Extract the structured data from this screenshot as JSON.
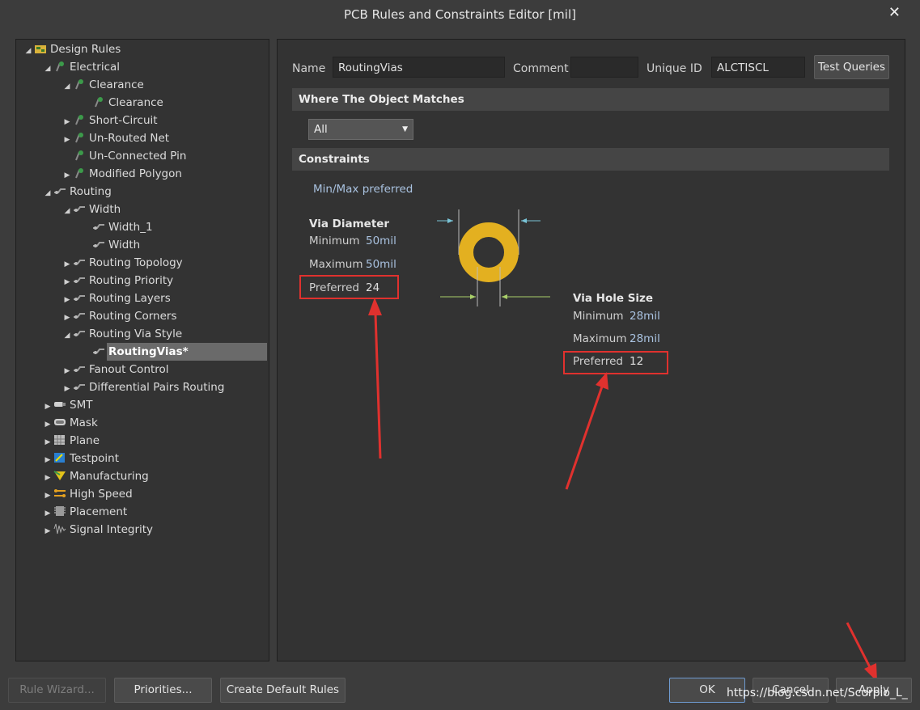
{
  "window": {
    "title": "PCB Rules and Constraints Editor [mil]"
  },
  "tree": [
    {
      "label": "Design Rules",
      "arrow": "◢",
      "icon": "rules-icon"
    },
    {
      "label": "Electrical",
      "arrow": "◢",
      "icon": "electrical-icon"
    },
    {
      "label": "Clearance",
      "arrow": "◢",
      "icon": "electrical-icon"
    },
    {
      "label": "Clearance",
      "arrow": "",
      "icon": "electrical-icon"
    },
    {
      "label": "Short-Circuit",
      "arrow": "▶",
      "icon": "electrical-icon"
    },
    {
      "label": "Un-Routed Net",
      "arrow": "▶",
      "icon": "electrical-icon"
    },
    {
      "label": "Un-Connected Pin",
      "arrow": "",
      "icon": "electrical-icon"
    },
    {
      "label": "Modified Polygon",
      "arrow": "▶",
      "icon": "electrical-icon"
    },
    {
      "label": "Routing",
      "arrow": "◢",
      "icon": "routing-icon"
    },
    {
      "label": "Width",
      "arrow": "◢",
      "icon": "routing-icon"
    },
    {
      "label": "Width_1",
      "arrow": "",
      "icon": "routing-icon"
    },
    {
      "label": "Width",
      "arrow": "",
      "icon": "routing-icon"
    },
    {
      "label": "Routing Topology",
      "arrow": "▶",
      "icon": "routing-icon"
    },
    {
      "label": "Routing Priority",
      "arrow": "▶",
      "icon": "routing-icon"
    },
    {
      "label": "Routing Layers",
      "arrow": "▶",
      "icon": "routing-icon"
    },
    {
      "label": "Routing Corners",
      "arrow": "▶",
      "icon": "routing-icon"
    },
    {
      "label": "Routing Via Style",
      "arrow": "◢",
      "icon": "routing-icon"
    },
    {
      "label": "RoutingVias*",
      "arrow": "",
      "icon": "routing-icon"
    },
    {
      "label": "Fanout Control",
      "arrow": "▶",
      "icon": "routing-icon"
    },
    {
      "label": "Differential Pairs Routing",
      "arrow": "▶",
      "icon": "routing-icon"
    },
    {
      "label": "SMT",
      "arrow": "▶",
      "icon": "smt-icon"
    },
    {
      "label": "Mask",
      "arrow": "▶",
      "icon": "mask-icon"
    },
    {
      "label": "Plane",
      "arrow": "▶",
      "icon": "plane-icon"
    },
    {
      "label": "Testpoint",
      "arrow": "▶",
      "icon": "testpoint-icon"
    },
    {
      "label": "Manufacturing",
      "arrow": "▶",
      "icon": "manufacturing-icon"
    },
    {
      "label": "High Speed",
      "arrow": "▶",
      "icon": "high-speed-icon"
    },
    {
      "label": "Placement",
      "arrow": "▶",
      "icon": "placement-icon"
    },
    {
      "label": "Signal Integrity",
      "arrow": "▶",
      "icon": "signal-integrity-icon"
    }
  ],
  "rule": {
    "name_label": "Name",
    "name_value": "RoutingVias",
    "comment_label": "Comment",
    "comment_value": "",
    "uid_label": "Unique ID",
    "uid_value": "ALCTISCL",
    "test_queries": "Test Queries"
  },
  "where": {
    "header": "Where The Object Matches",
    "selected": "All"
  },
  "constraints": {
    "header": "Constraints",
    "mode": "Min/Max preferred",
    "via_diameter": {
      "title": "Via Diameter",
      "min_label": "Minimum",
      "min": "50mil",
      "max_label": "Maximum",
      "max": "50mil",
      "pref_label": "Preferred",
      "pref": "24"
    },
    "via_hole": {
      "title": "Via Hole Size",
      "min_label": "Minimum",
      "min": "28mil",
      "max_label": "Maximum",
      "max": "28mil",
      "pref_label": "Preferred",
      "pref": "12"
    }
  },
  "buttons": {
    "rule_wizard": "Rule Wizard...",
    "priorities": "Priorities...",
    "create_defaults": "Create Default Rules",
    "ok": "OK",
    "cancel": "Cancel",
    "apply": "Apply"
  },
  "watermark": "https://blog.csdn.net/Scorpio_L_",
  "colors": {
    "via": "#e3b020",
    "annotation": "#e0312e",
    "selection": "#6a6a6a"
  }
}
